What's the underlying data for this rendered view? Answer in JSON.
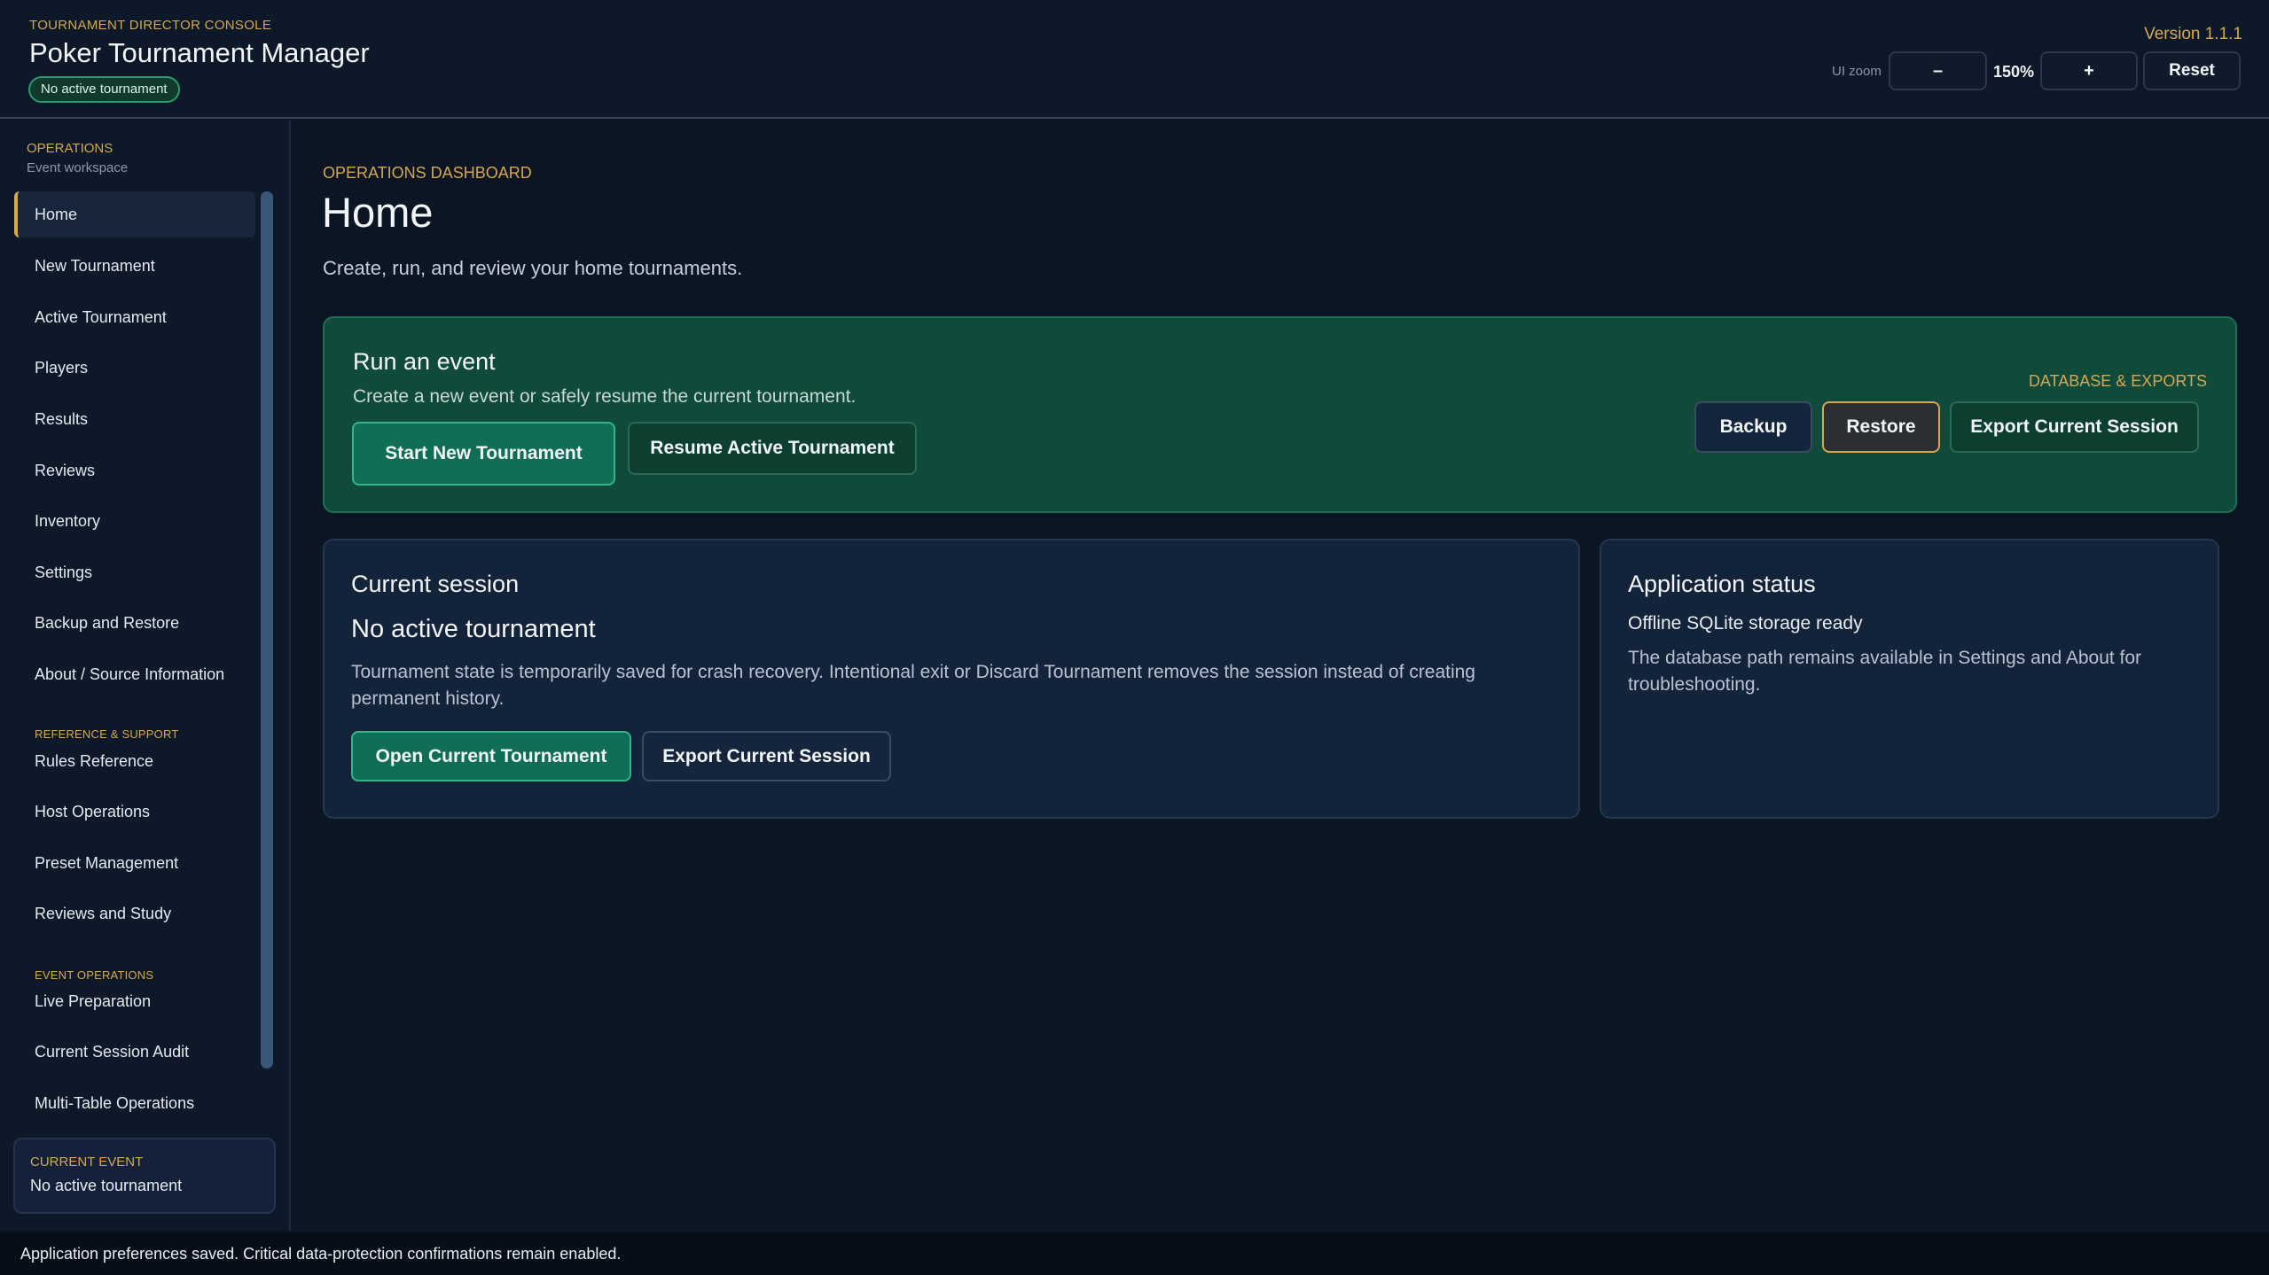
{
  "header": {
    "eyebrow": "TOURNAMENT DIRECTOR CONSOLE",
    "title": "Poker Tournament Manager",
    "status_pill": "No active tournament",
    "version": "Version 1.1.1",
    "zoom": {
      "label": "UI zoom",
      "decrease_label": "–",
      "value": "150%",
      "increase_label": "+",
      "reset_label": "Reset"
    }
  },
  "sidebar": {
    "eyebrow": "OPERATIONS",
    "subtitle": "Event workspace",
    "items": [
      {
        "label": "Home"
      },
      {
        "label": "New Tournament"
      },
      {
        "label": "Active Tournament"
      },
      {
        "label": "Players"
      },
      {
        "label": "Results"
      },
      {
        "label": "Reviews"
      },
      {
        "label": "Inventory"
      },
      {
        "label": "Settings"
      },
      {
        "label": "Backup and Restore"
      },
      {
        "label": "About / Source Information"
      }
    ],
    "reference_group": {
      "label": "REFERENCE & SUPPORT",
      "items": [
        {
          "label": "Rules Reference"
        },
        {
          "label": "Host Operations"
        },
        {
          "label": "Preset Management"
        },
        {
          "label": "Reviews and Study"
        }
      ]
    },
    "event_group": {
      "label": "EVENT OPERATIONS",
      "items": [
        {
          "label": "Live Preparation"
        },
        {
          "label": "Current Session Audit"
        },
        {
          "label": "Multi-Table Operations"
        }
      ]
    },
    "current_event": {
      "label": "CURRENT EVENT",
      "value": "No active tournament"
    }
  },
  "main": {
    "eyebrow": "OPERATIONS DASHBOARD",
    "title": "Home",
    "description": "Create, run, and review your home tournaments.",
    "run_event": {
      "title": "Run an event",
      "subtitle": "Create a new event or safely resume the current tournament.",
      "start_label": "Start New Tournament",
      "resume_label": "Resume Active Tournament",
      "db_label": "DATABASE & EXPORTS",
      "backup_label": "Backup",
      "restore_label": "Restore",
      "export_label": "Export Current Session"
    },
    "current_session": {
      "heading": "Current session",
      "status": "No active tournament",
      "description": "Tournament state is temporarily saved for crash recovery. Intentional exit or Discard Tournament removes the session instead of creating permanent history.",
      "open_label": "Open Current Tournament",
      "export_label": "Export Current Session"
    },
    "app_status": {
      "heading": "Application status",
      "status": "Offline SQLite storage ready",
      "description": "The database path remains available in Settings and About for troubleshooting."
    }
  },
  "statusbar": {
    "message": "Application preferences saved. Critical data-protection confirmations remain enabled."
  },
  "colors": {
    "background": "#0b1524",
    "accent_gold": "#d4a852",
    "accent_green": "#0f6e55",
    "card_green": "#0f4a3a",
    "panel": "#13233a"
  }
}
